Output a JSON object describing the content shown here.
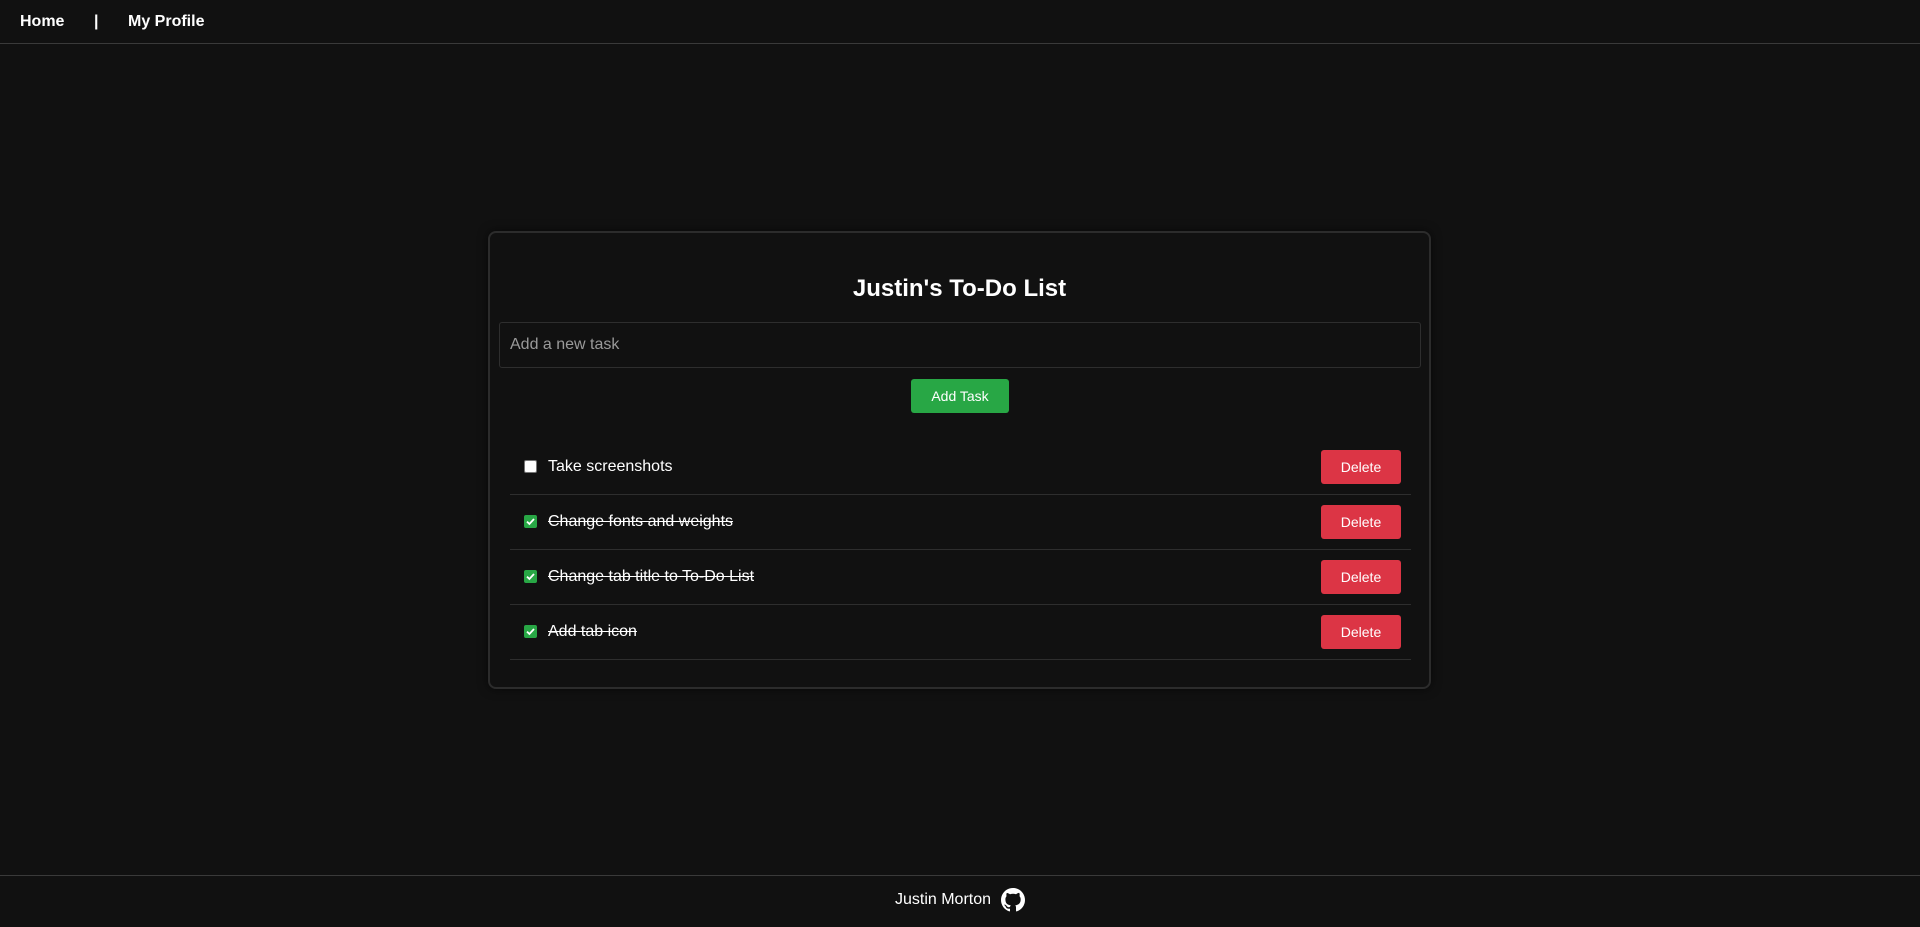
{
  "nav": {
    "home_label": "Home",
    "separator": "|",
    "profile_label": "My Profile"
  },
  "todo": {
    "title": "Justin's To-Do List",
    "input_placeholder": "Add a new task",
    "input_value": "",
    "add_label": "Add Task",
    "tasks": [
      {
        "text": "Take screenshots",
        "done": false,
        "delete_label": "Delete"
      },
      {
        "text": "Change fonts and weights",
        "done": true,
        "delete_label": "Delete"
      },
      {
        "text": "Change tab title to To-Do List",
        "done": true,
        "delete_label": "Delete"
      },
      {
        "text": "Add tab icon",
        "done": true,
        "delete_label": "Delete"
      }
    ]
  },
  "footer": {
    "author": "Justin Morton",
    "icon": "github-icon"
  },
  "colors": {
    "background": "#111111",
    "add_button": "#28a745",
    "delete_button": "#dc3545",
    "checkbox_checked": "#28a745"
  }
}
